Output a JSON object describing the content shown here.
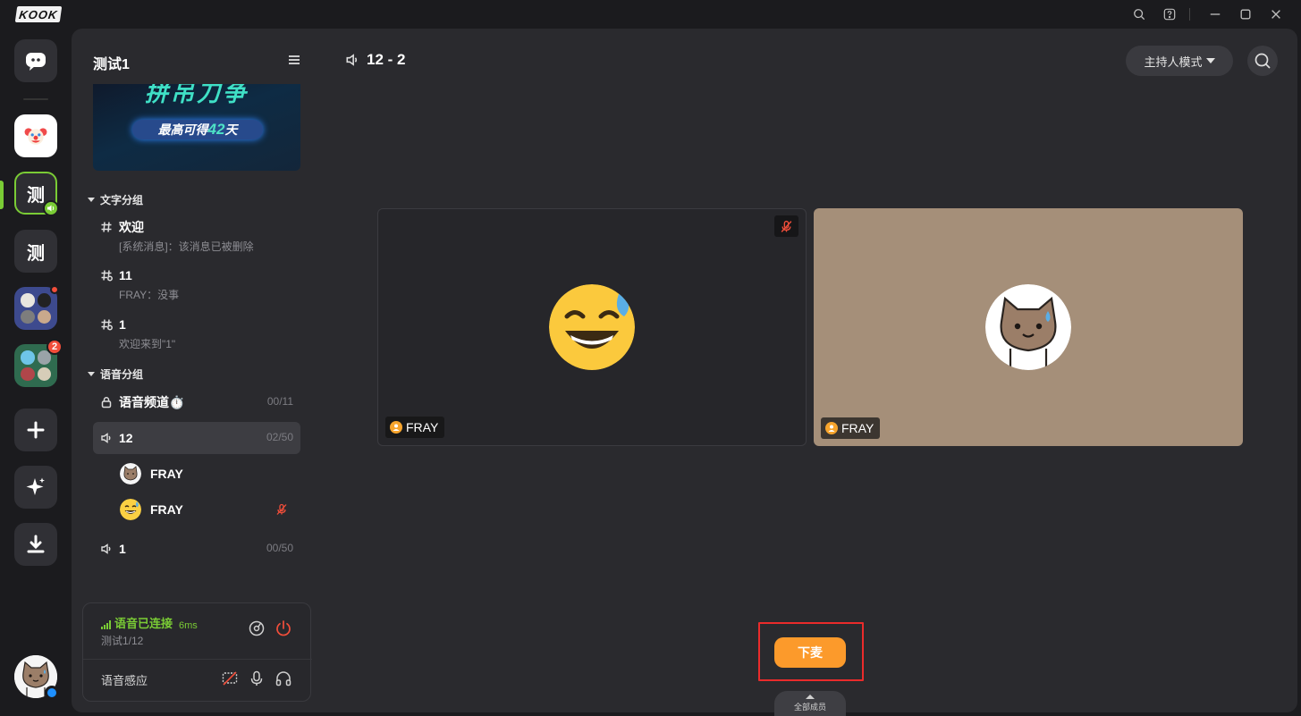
{
  "app": {
    "logo_text": "KOOK"
  },
  "window_controls": [
    "search-icon",
    "help-icon",
    "minimize-icon",
    "maximize-icon",
    "close-icon"
  ],
  "rail": {
    "items": [
      {
        "name": "direct-messages",
        "icon": "chat-bubble-icon"
      },
      {
        "name": "clown-server",
        "icon": "clown-face"
      },
      {
        "name": "test-server-active",
        "text": "测"
      },
      {
        "name": "test-server-2",
        "text": "测"
      },
      {
        "name": "server-folder-1"
      },
      {
        "name": "server-folder-2",
        "badge": "2"
      },
      {
        "name": "add-server",
        "icon": "plus-icon"
      },
      {
        "name": "discover",
        "icon": "sparkle-icon"
      },
      {
        "name": "download",
        "icon": "download-icon"
      }
    ]
  },
  "panel": {
    "guild_name": "测试1",
    "banner": {
      "headline": "拼吊刀争",
      "pill_prefix": "最高可得",
      "pill_number": "42",
      "pill_suffix": "天"
    },
    "text_group": {
      "label": "文字分组",
      "channels": [
        {
          "name": "欢迎",
          "preview": "[系统消息]：该消息已被删除",
          "icon": "hash-icon"
        },
        {
          "name": "11",
          "preview": "FRAY：没事",
          "icon": "hash-muted-icon"
        },
        {
          "name": "1",
          "preview": "欢迎来到\"1\"",
          "icon": "hash-muted-icon"
        }
      ]
    },
    "voice_group": {
      "label": "语音分组",
      "channels": [
        {
          "name": "语音频道⏱️",
          "count": "00/11",
          "icon": "lock-icon"
        },
        {
          "name": "12",
          "count": "02/50",
          "icon": "speaker-icon",
          "selected": true
        },
        {
          "name": "1",
          "count": "00/50",
          "icon": "speaker-icon"
        }
      ],
      "members": [
        {
          "name": "FRAY",
          "avatar": "cat-avatar",
          "muted": false
        },
        {
          "name": "FRAY",
          "avatar": "sweat-smile-emoji",
          "muted": true
        }
      ]
    },
    "voice_status": {
      "status": "语音已连接",
      "latency": "6ms",
      "location": "测试1/12",
      "mode_label": "语音感应"
    }
  },
  "main": {
    "title": "12 - 2",
    "host_mode_label": "主持人模式",
    "tiles": [
      {
        "name": "FRAY",
        "avatar": "sweat-smile-emoji",
        "muted": true,
        "bg": "#26262a"
      },
      {
        "name": "FRAY",
        "avatar": "cat-avatar",
        "muted": false,
        "bg": "#a58f79"
      }
    ],
    "leave_stage_label": "下麦",
    "all_members_label": "全部成员"
  },
  "colors": {
    "accent_green": "#7acc35",
    "accent_orange": "#fc9a2b",
    "alert_red": "#f24e3a",
    "highlight_red": "#ea2b2b"
  }
}
